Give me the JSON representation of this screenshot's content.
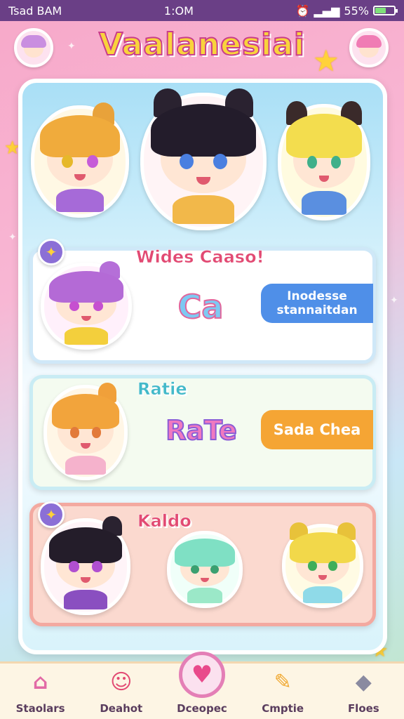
{
  "status_bar": {
    "carrier_time": "Tsad BAM",
    "clock": "1:OM",
    "battery_text": "55%",
    "battery_level": 0.55
  },
  "header": {
    "app_title": "Vaalanesiai"
  },
  "cards": [
    {
      "title": "Wides Caaso!",
      "art_text": "Ca",
      "button_label": "Inodesse stannaitdan"
    },
    {
      "title": "Ratie",
      "art_text": "RaTe",
      "button_label": "Sada Chea"
    },
    {
      "title": "Kaldo"
    }
  ],
  "bottom_nav": [
    {
      "label": "Staolars",
      "icon": "home-icon"
    },
    {
      "label": "Deahot",
      "icon": "character-icon"
    },
    {
      "label": "Dceopec",
      "icon": "heart-icon"
    },
    {
      "label": "Cmptie",
      "icon": "paint-icon"
    },
    {
      "label": "Floes",
      "icon": "gem-icon"
    }
  ],
  "colors": {
    "status_bar": "#6a3f86",
    "accent_pink": "#e24a73",
    "pill_blue": "#4f8fe8",
    "pill_orange": "#f5a534"
  }
}
